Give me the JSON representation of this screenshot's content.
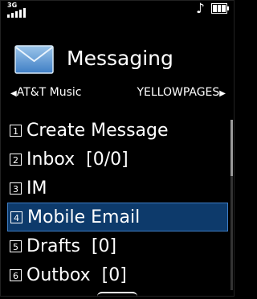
{
  "status": {
    "network": "3G",
    "battery_level": 1.0
  },
  "header": {
    "title": "Messaging",
    "left_nav": "AT&T Music",
    "right_nav": "YELLOWPAGES"
  },
  "menu": {
    "items": [
      {
        "num": "1",
        "label": "Create Message"
      },
      {
        "num": "2",
        "label": "Inbox  [0/0]"
      },
      {
        "num": "3",
        "label": "IM"
      },
      {
        "num": "4",
        "label": "Mobile Email",
        "selected": true
      },
      {
        "num": "5",
        "label": "Drafts  [0]"
      },
      {
        "num": "6",
        "label": "Outbox  [0]"
      }
    ]
  },
  "colors": {
    "selection": "#0d3a6b",
    "selection_border": "#3f7ec5",
    "envelope": "#6aa2d6"
  }
}
